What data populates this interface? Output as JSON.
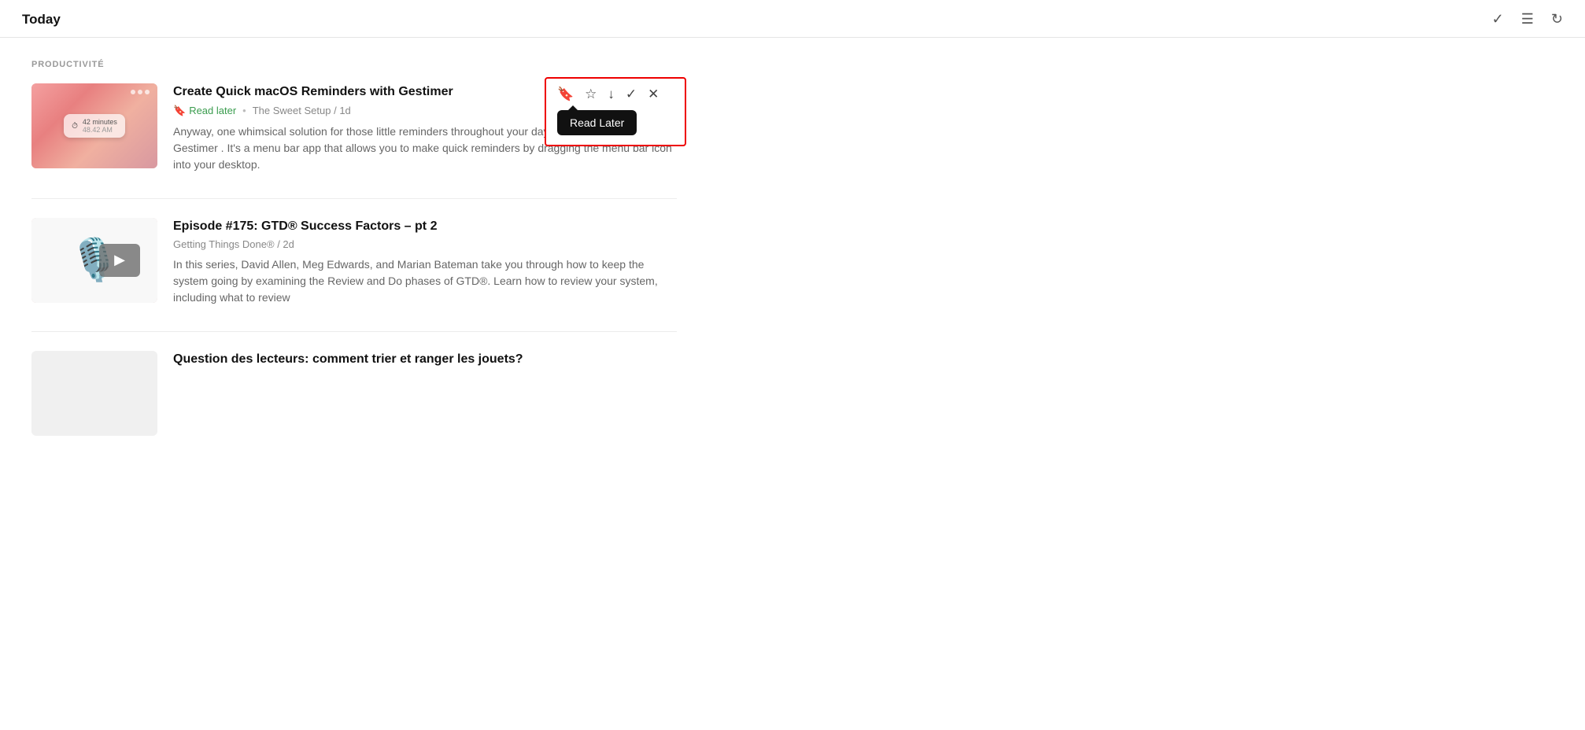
{
  "header": {
    "title": "Today",
    "check_icon": "✓",
    "list_icon": "☰",
    "refresh_icon": "↻"
  },
  "section": {
    "label": "PRODUCTIVITÉ"
  },
  "articles": [
    {
      "id": "gestimer",
      "title": "Create Quick macOS Reminders with Gestimer",
      "read_later_label": "Read later",
      "source": "The Sweet Setup",
      "age": "1d",
      "excerpt": "Anyway, one whimsical solution for those little reminders throughout your day is a Mac app called Gestimer . It's a menu bar app that allows you to make quick reminders by dragging the menu bar icon into your desktop.",
      "has_toolbar": true,
      "toolbar": {
        "bookmark_label": "Read Later",
        "icons": [
          "bookmark",
          "star",
          "download",
          "check",
          "close"
        ]
      }
    },
    {
      "id": "gtd",
      "title": "Episode #175: GTD® Success Factors – pt 2",
      "source": "Getting Things Done®",
      "age": "2d",
      "excerpt": "In this series, David Allen, Meg Edwards, and Marian Bateman take you through how to keep the system going by examining the Review and Do phases of GTD®. Learn how to review your system, including what to review",
      "has_toolbar": false
    },
    {
      "id": "jouets",
      "title": "Question des lecteurs: comment trier et ranger les jouets?",
      "source": "",
      "age": "",
      "excerpt": "",
      "has_toolbar": false
    }
  ]
}
